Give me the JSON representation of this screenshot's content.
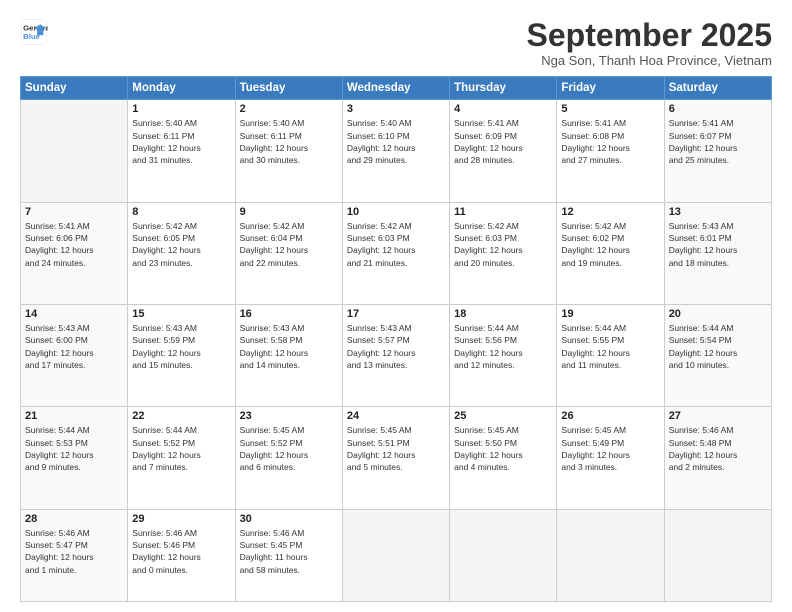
{
  "logo": {
    "line1": "General",
    "line2": "Blue"
  },
  "title": "September 2025",
  "location": "Nga Son, Thanh Hoa Province, Vietnam",
  "weekdays": [
    "Sunday",
    "Monday",
    "Tuesday",
    "Wednesday",
    "Thursday",
    "Friday",
    "Saturday"
  ],
  "weeks": [
    [
      {
        "day": "",
        "info": ""
      },
      {
        "day": "1",
        "info": "Sunrise: 5:40 AM\nSunset: 6:11 PM\nDaylight: 12 hours\nand 31 minutes."
      },
      {
        "day": "2",
        "info": "Sunrise: 5:40 AM\nSunset: 6:11 PM\nDaylight: 12 hours\nand 30 minutes."
      },
      {
        "day": "3",
        "info": "Sunrise: 5:40 AM\nSunset: 6:10 PM\nDaylight: 12 hours\nand 29 minutes."
      },
      {
        "day": "4",
        "info": "Sunrise: 5:41 AM\nSunset: 6:09 PM\nDaylight: 12 hours\nand 28 minutes."
      },
      {
        "day": "5",
        "info": "Sunrise: 5:41 AM\nSunset: 6:08 PM\nDaylight: 12 hours\nand 27 minutes."
      },
      {
        "day": "6",
        "info": "Sunrise: 5:41 AM\nSunset: 6:07 PM\nDaylight: 12 hours\nand 25 minutes."
      }
    ],
    [
      {
        "day": "7",
        "info": "Sunrise: 5:41 AM\nSunset: 6:06 PM\nDaylight: 12 hours\nand 24 minutes."
      },
      {
        "day": "8",
        "info": "Sunrise: 5:42 AM\nSunset: 6:05 PM\nDaylight: 12 hours\nand 23 minutes."
      },
      {
        "day": "9",
        "info": "Sunrise: 5:42 AM\nSunset: 6:04 PM\nDaylight: 12 hours\nand 22 minutes."
      },
      {
        "day": "10",
        "info": "Sunrise: 5:42 AM\nSunset: 6:03 PM\nDaylight: 12 hours\nand 21 minutes."
      },
      {
        "day": "11",
        "info": "Sunrise: 5:42 AM\nSunset: 6:03 PM\nDaylight: 12 hours\nand 20 minutes."
      },
      {
        "day": "12",
        "info": "Sunrise: 5:42 AM\nSunset: 6:02 PM\nDaylight: 12 hours\nand 19 minutes."
      },
      {
        "day": "13",
        "info": "Sunrise: 5:43 AM\nSunset: 6:01 PM\nDaylight: 12 hours\nand 18 minutes."
      }
    ],
    [
      {
        "day": "14",
        "info": "Sunrise: 5:43 AM\nSunset: 6:00 PM\nDaylight: 12 hours\nand 17 minutes."
      },
      {
        "day": "15",
        "info": "Sunrise: 5:43 AM\nSunset: 5:59 PM\nDaylight: 12 hours\nand 15 minutes."
      },
      {
        "day": "16",
        "info": "Sunrise: 5:43 AM\nSunset: 5:58 PM\nDaylight: 12 hours\nand 14 minutes."
      },
      {
        "day": "17",
        "info": "Sunrise: 5:43 AM\nSunset: 5:57 PM\nDaylight: 12 hours\nand 13 minutes."
      },
      {
        "day": "18",
        "info": "Sunrise: 5:44 AM\nSunset: 5:56 PM\nDaylight: 12 hours\nand 12 minutes."
      },
      {
        "day": "19",
        "info": "Sunrise: 5:44 AM\nSunset: 5:55 PM\nDaylight: 12 hours\nand 11 minutes."
      },
      {
        "day": "20",
        "info": "Sunrise: 5:44 AM\nSunset: 5:54 PM\nDaylight: 12 hours\nand 10 minutes."
      }
    ],
    [
      {
        "day": "21",
        "info": "Sunrise: 5:44 AM\nSunset: 5:53 PM\nDaylight: 12 hours\nand 9 minutes."
      },
      {
        "day": "22",
        "info": "Sunrise: 5:44 AM\nSunset: 5:52 PM\nDaylight: 12 hours\nand 7 minutes."
      },
      {
        "day": "23",
        "info": "Sunrise: 5:45 AM\nSunset: 5:52 PM\nDaylight: 12 hours\nand 6 minutes."
      },
      {
        "day": "24",
        "info": "Sunrise: 5:45 AM\nSunset: 5:51 PM\nDaylight: 12 hours\nand 5 minutes."
      },
      {
        "day": "25",
        "info": "Sunrise: 5:45 AM\nSunset: 5:50 PM\nDaylight: 12 hours\nand 4 minutes."
      },
      {
        "day": "26",
        "info": "Sunrise: 5:45 AM\nSunset: 5:49 PM\nDaylight: 12 hours\nand 3 minutes."
      },
      {
        "day": "27",
        "info": "Sunrise: 5:46 AM\nSunset: 5:48 PM\nDaylight: 12 hours\nand 2 minutes."
      }
    ],
    [
      {
        "day": "28",
        "info": "Sunrise: 5:46 AM\nSunset: 5:47 PM\nDaylight: 12 hours\nand 1 minute."
      },
      {
        "day": "29",
        "info": "Sunrise: 5:46 AM\nSunset: 5:46 PM\nDaylight: 12 hours\nand 0 minutes."
      },
      {
        "day": "30",
        "info": "Sunrise: 5:46 AM\nSunset: 5:45 PM\nDaylight: 11 hours\nand 58 minutes."
      },
      {
        "day": "",
        "info": ""
      },
      {
        "day": "",
        "info": ""
      },
      {
        "day": "",
        "info": ""
      },
      {
        "day": "",
        "info": ""
      }
    ]
  ]
}
